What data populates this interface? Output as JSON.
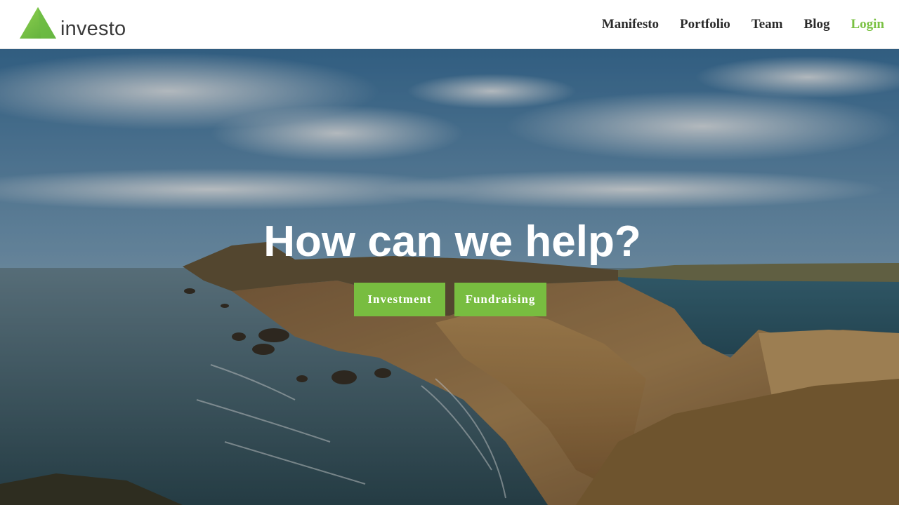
{
  "header": {
    "logo": {
      "text": "investo",
      "mark_icon": "green-triangle-logo-icon"
    },
    "nav": {
      "items": [
        {
          "label": "Manifesto"
        },
        {
          "label": "Portfolio"
        },
        {
          "label": "Team"
        },
        {
          "label": "Blog"
        }
      ],
      "login_label": "Login"
    }
  },
  "hero": {
    "background": "coastal cliffs and ocean photo",
    "title": "How can we help?",
    "buttons": {
      "investment_label": "Investment",
      "fundraising_label": "Fundraising"
    }
  },
  "colors": {
    "brand_green": "#78bd40",
    "login_green": "#7ac143",
    "nav_text": "#2b2b2b",
    "header_bg": "#ffffff"
  }
}
